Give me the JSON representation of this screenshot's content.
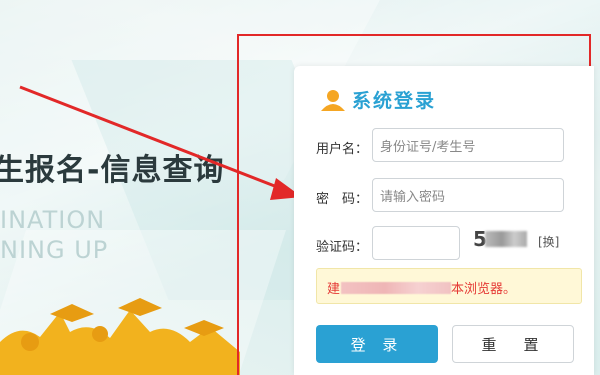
{
  "hero": {
    "headline": "生报名-信息查询",
    "sub_line1": "INATION",
    "sub_line2": "NING UP"
  },
  "login": {
    "title": "系统登录",
    "username_label": "用户名：",
    "username_placeholder": "身份证号/考生号",
    "password_label": "密　码：",
    "password_placeholder": "请输入密码",
    "captcha_label": "验证码：",
    "captcha_text": "5",
    "captcha_refresh": "[换]",
    "notice_prefix": "建",
    "notice_suffix": "本浏览器。",
    "login_button": "登 录",
    "reset_button": "重　置"
  },
  "colors": {
    "accent": "#2aa1d3",
    "annotation_red": "#e22828",
    "notice_bg": "#fff8d7",
    "notice_text": "#e53935"
  },
  "icons": [
    "user-icon",
    "annotation-arrow"
  ]
}
